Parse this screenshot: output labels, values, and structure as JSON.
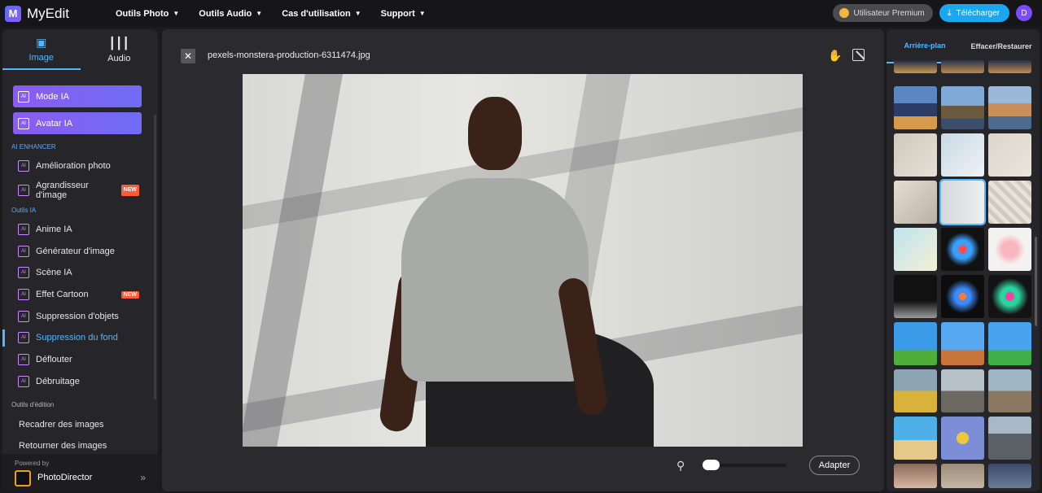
{
  "app": {
    "name": "MyEdit",
    "logo_letter": "M"
  },
  "nav": [
    {
      "label": "Outils Photo"
    },
    {
      "label": "Outils Audio"
    },
    {
      "label": "Cas d'utilisation"
    },
    {
      "label": "Support"
    }
  ],
  "header": {
    "premium_label": "Utilisateur Premium",
    "download_label": "Télécharger",
    "avatar_letter": "D"
  },
  "sidebar": {
    "tabs": [
      {
        "label": "Image",
        "active": true
      },
      {
        "label": "Audio",
        "active": false
      }
    ],
    "ai_buttons": [
      {
        "label": "Mode IA"
      },
      {
        "label": "Avatar IA"
      }
    ],
    "sections": {
      "enhancer": "AI ENHANCER",
      "ai_tools": "Outils IA",
      "edit_tools": "Outils d'édition"
    },
    "enhancer_items": [
      {
        "label": "Amélioration photo"
      },
      {
        "label": "Agrandisseur d'image",
        "badge": "NEW"
      }
    ],
    "ai_items": [
      {
        "label": "Anime IA"
      },
      {
        "label": "Générateur d'image"
      },
      {
        "label": "Scène IA"
      },
      {
        "label": "Effet Cartoon",
        "badge": "NEW"
      },
      {
        "label": "Suppression d'objets"
      },
      {
        "label": "Suppression du fond",
        "active": true
      },
      {
        "label": "Déflouter"
      },
      {
        "label": "Débruitage"
      }
    ],
    "edit_items": [
      {
        "label": "Recadrer des images"
      },
      {
        "label": "Retourner des images"
      }
    ],
    "powered": {
      "label": "Powered by",
      "product": "PhotoDirector",
      "arrow": "»"
    }
  },
  "canvas": {
    "file_name": "pexels-monstera-production-6311474.jpg",
    "fit_label": "Adapter",
    "zoom_level": 0
  },
  "right_panel": {
    "tabs": [
      {
        "label": "Arrière-plan",
        "active": true
      },
      {
        "label": "Effacer/Restaurer",
        "active": false
      }
    ]
  },
  "colors": {
    "accent": "#4fb8ff",
    "download": "#1aa7f0",
    "premium_bg": "#4a4a4f",
    "new_badge": "#ff5a36"
  }
}
